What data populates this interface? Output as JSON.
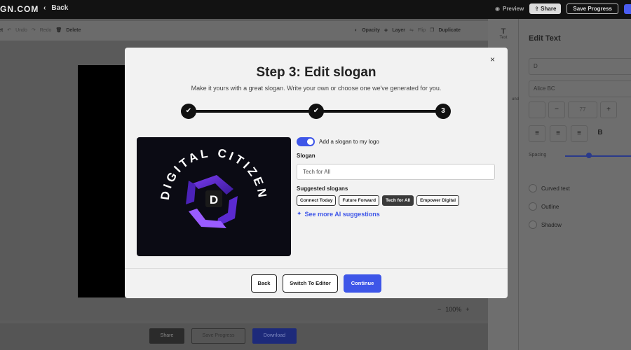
{
  "topbar": {
    "brand": "GN.COM",
    "back_label": "Back",
    "preview_label": "Preview",
    "share_label": "Share",
    "save_label": "Save Progress"
  },
  "toolbar": {
    "reset": "et",
    "undo": "Undo",
    "redo": "Redo",
    "delete": "Delete",
    "opacity": "Opacity",
    "layer": "Layer",
    "flip": "Flip",
    "duplicate": "Duplicate"
  },
  "side_tabs": [
    "Text",
    "",
    "und",
    ""
  ],
  "panel": {
    "title": "Edit Text",
    "text_value": "D",
    "font_value": "Alice BC",
    "size_minus": "−",
    "size_value": "77",
    "size_plus": "+",
    "spacing_label": "Spacing",
    "curved_text": "Curved text",
    "outline": "Outline",
    "shadow": "Shadow"
  },
  "zoom": {
    "minus": "−",
    "value": "100%",
    "plus": "+"
  },
  "bottom": {
    "share": "Share",
    "save": "Save Progress",
    "download": "Download"
  },
  "modal": {
    "close": "×",
    "title": "Step 3: Edit slogan",
    "subtitle": "Make it yours with a great slogan. Write your own or choose one we've generated for you.",
    "steps": [
      "✔",
      "✔",
      "3"
    ],
    "logo_text": "DIGITAL CITIZEN",
    "logo_letter": "D",
    "toggle_label": "Add a slogan to my logo",
    "slogan_label": "Slogan",
    "slogan_value": "Tech for All",
    "suggested_label": "Suggested slogans",
    "suggestions": [
      "Connect Today",
      "Future Forward",
      "Tech for All",
      "Empower Digital"
    ],
    "ai_link": "See more AI suggestions",
    "back": "Back",
    "switch": "Switch To Editor",
    "continue": "Continue"
  },
  "colors": {
    "accent": "#3e56e8",
    "dark": "#111111"
  }
}
